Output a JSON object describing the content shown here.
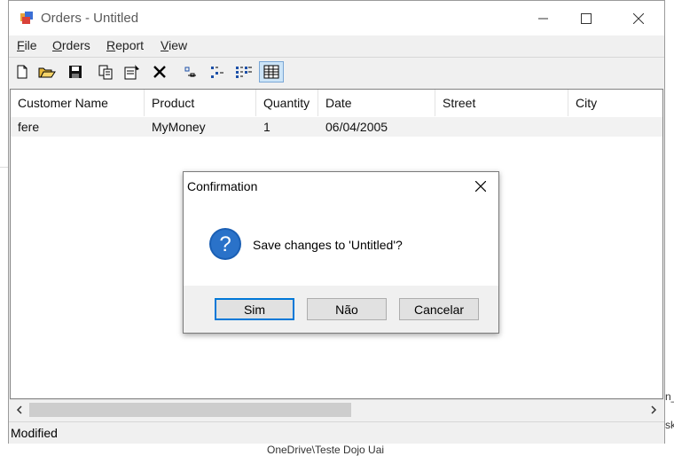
{
  "background": {
    "text1": "n_",
    "text2": "sk",
    "text3": "OneDrive\\Teste Dojo Uai"
  },
  "window": {
    "title": "Orders - Untitled",
    "icon": "app-icon",
    "controls": {
      "minimize": "minimize-icon",
      "maximize": "maximize-icon",
      "close": "close-icon"
    }
  },
  "menu": {
    "items": [
      {
        "accel": "F",
        "rest": "ile"
      },
      {
        "accel": "O",
        "rest": "rders"
      },
      {
        "accel": "R",
        "rest": "eport"
      },
      {
        "accel": "V",
        "rest": "iew"
      }
    ]
  },
  "toolbar": {
    "buttons": [
      "new-icon",
      "open-icon",
      "save-icon",
      "copy-icon",
      "properties-icon",
      "delete-icon",
      "large-icons-icon",
      "small-icons-icon",
      "list-icon",
      "details-icon"
    ],
    "active": "details-icon"
  },
  "grid": {
    "columns": [
      "Customer Name",
      "Product",
      "Quantity",
      "Date",
      "Street",
      "City"
    ],
    "rows": [
      [
        "fere",
        "MyMoney",
        "1",
        "06/04/2005",
        "",
        ""
      ]
    ]
  },
  "status": {
    "text": "Modified"
  },
  "dialog": {
    "title": "Confirmation",
    "message": "Save changes to 'Untitled'?",
    "icon": "question-icon",
    "buttons": {
      "yes": "Sim",
      "no": "Não",
      "cancel": "Cancelar"
    }
  },
  "colors": {
    "accent": "#0078d7",
    "selected_row": "#f2f2f2",
    "question_icon": "#1a5fb4"
  }
}
